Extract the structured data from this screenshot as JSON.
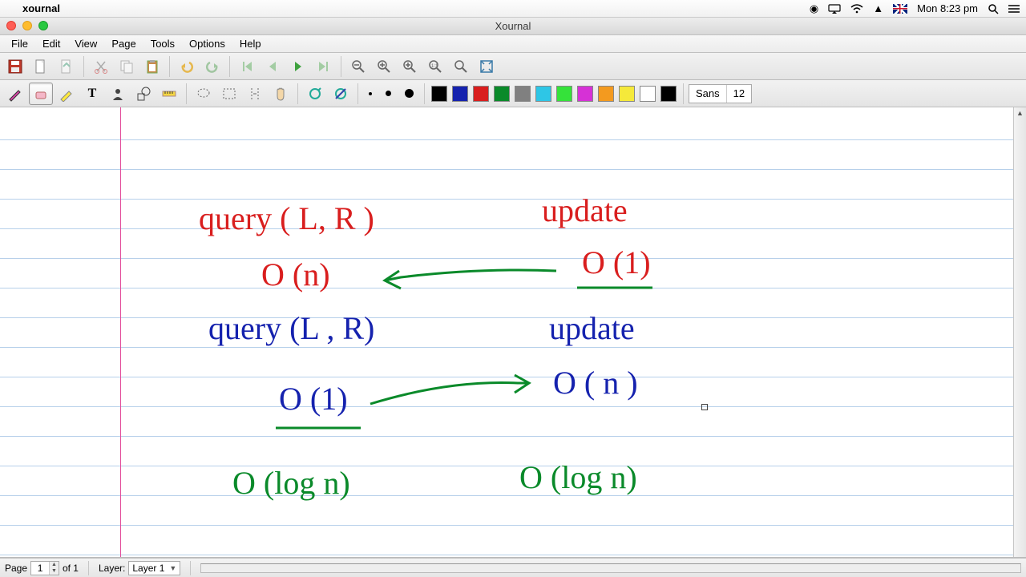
{
  "mac": {
    "app_name": "xournal",
    "clock": "Mon 8:23 pm"
  },
  "window": {
    "title": "Xournal"
  },
  "menu": {
    "file": "File",
    "edit": "Edit",
    "view": "View",
    "page": "Page",
    "tools": "Tools",
    "options": "Options",
    "help": "Help"
  },
  "font": {
    "family": "Sans",
    "size": "12"
  },
  "colors": {
    "swatches": [
      "#000000",
      "#1522ae",
      "#d91e1e",
      "#0a8a2a",
      "#808080",
      "#2ec6e6",
      "#35e23a",
      "#d631d6",
      "#f39a1f",
      "#f5e93a",
      "#ffffff",
      "#000000"
    ]
  },
  "notes": {
    "r1": "query ( L, R )",
    "r2": "update",
    "r3": "O (n)",
    "r4": "O (1)",
    "b1": "query (L , R)",
    "b2": "update",
    "b3": "O (1)",
    "b4": "O ( n )",
    "g1": "O (log n)",
    "g2": "O (log n)"
  },
  "status": {
    "page_label": "Page",
    "page_num": "1",
    "page_of": "of 1",
    "layer_label": "Layer:",
    "layer_value": "Layer 1"
  }
}
